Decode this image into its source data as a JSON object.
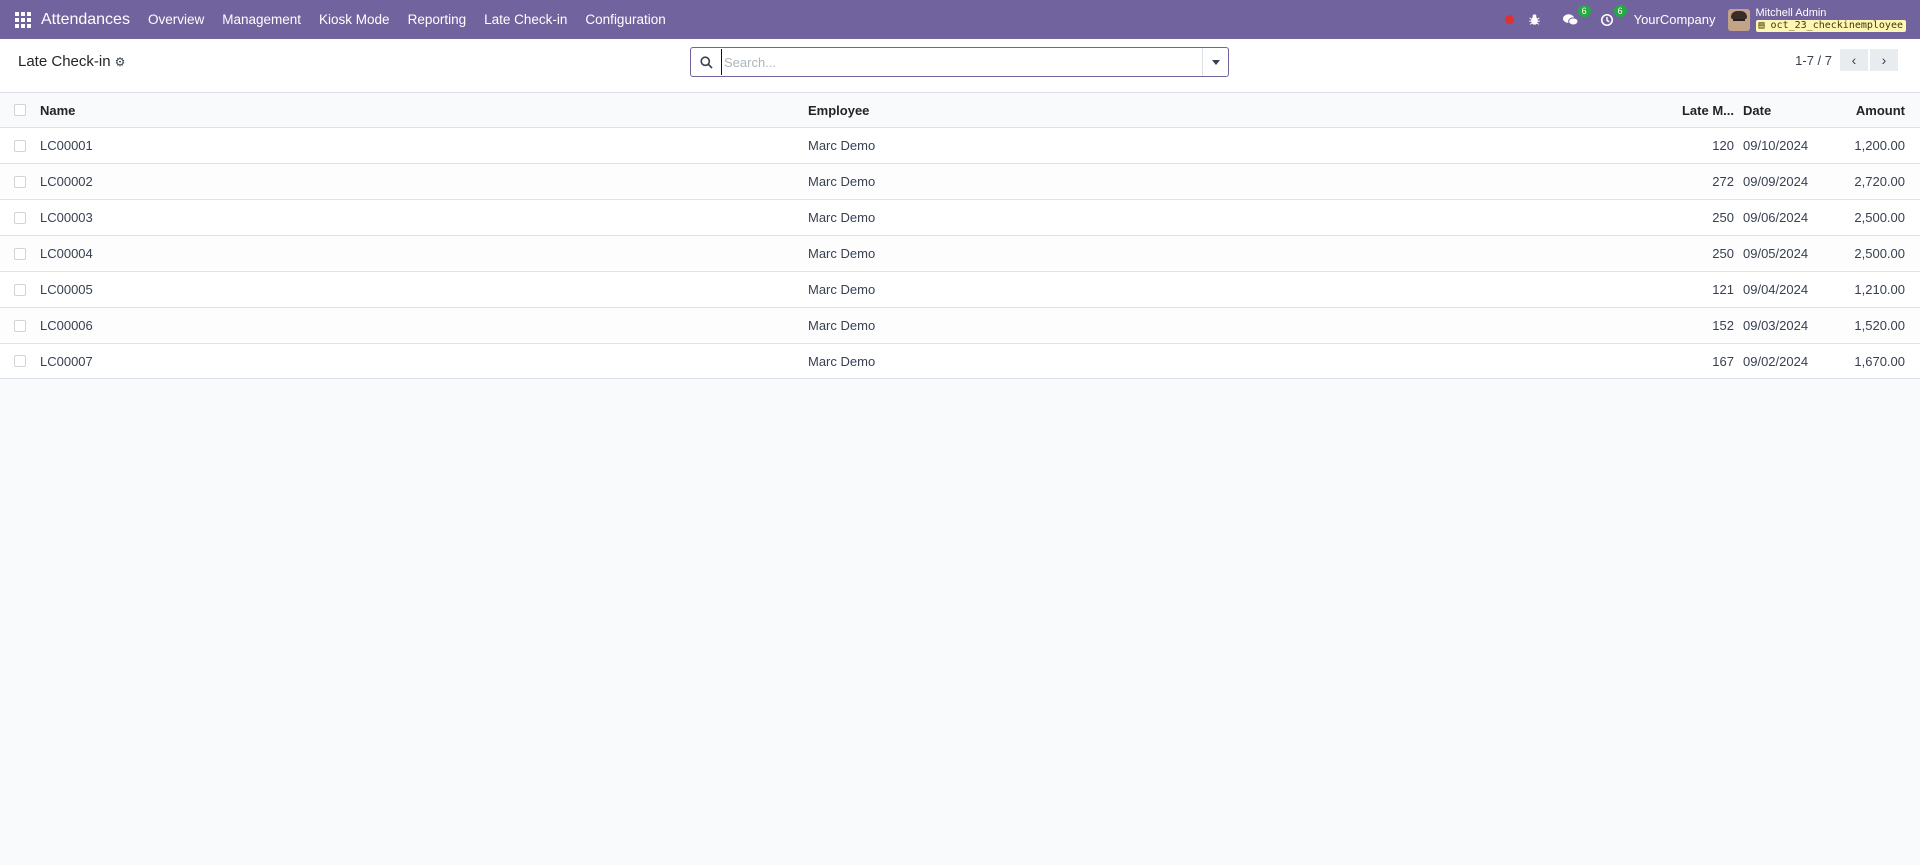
{
  "navbar": {
    "app_name": "Attendances",
    "menu": [
      "Overview",
      "Management",
      "Kiosk Mode",
      "Reporting",
      "Late Check-in",
      "Configuration"
    ],
    "messages_count": "6",
    "activities_count": "6",
    "company": "YourCompany",
    "user_name": "Mitchell Admin",
    "database": "oct_23_checkinemployee"
  },
  "control_panel": {
    "breadcrumb": "Late Check-in",
    "search_placeholder": "Search...",
    "pager_value": "1-7 / 7"
  },
  "list": {
    "columns": {
      "name": "Name",
      "employee": "Employee",
      "late_minutes": "Late M...",
      "date": "Date",
      "amount": "Amount"
    },
    "rows": [
      {
        "name": "LC00001",
        "employee": "Marc Demo",
        "late_minutes": "120",
        "date": "09/10/2024",
        "amount": "1,200.00"
      },
      {
        "name": "LC00002",
        "employee": "Marc Demo",
        "late_minutes": "272",
        "date": "09/09/2024",
        "amount": "2,720.00"
      },
      {
        "name": "LC00003",
        "employee": "Marc Demo",
        "late_minutes": "250",
        "date": "09/06/2024",
        "amount": "2,500.00"
      },
      {
        "name": "LC00004",
        "employee": "Marc Demo",
        "late_minutes": "250",
        "date": "09/05/2024",
        "amount": "2,500.00"
      },
      {
        "name": "LC00005",
        "employee": "Marc Demo",
        "late_minutes": "121",
        "date": "09/04/2024",
        "amount": "1,210.00"
      },
      {
        "name": "LC00006",
        "employee": "Marc Demo",
        "late_minutes": "152",
        "date": "09/03/2024",
        "amount": "1,520.00"
      },
      {
        "name": "LC00007",
        "employee": "Marc Demo",
        "late_minutes": "167",
        "date": "09/02/2024",
        "amount": "1,670.00"
      }
    ]
  },
  "colors": {
    "navbar": "#71639e",
    "badge": "#28a745",
    "recording": "#e03131"
  }
}
